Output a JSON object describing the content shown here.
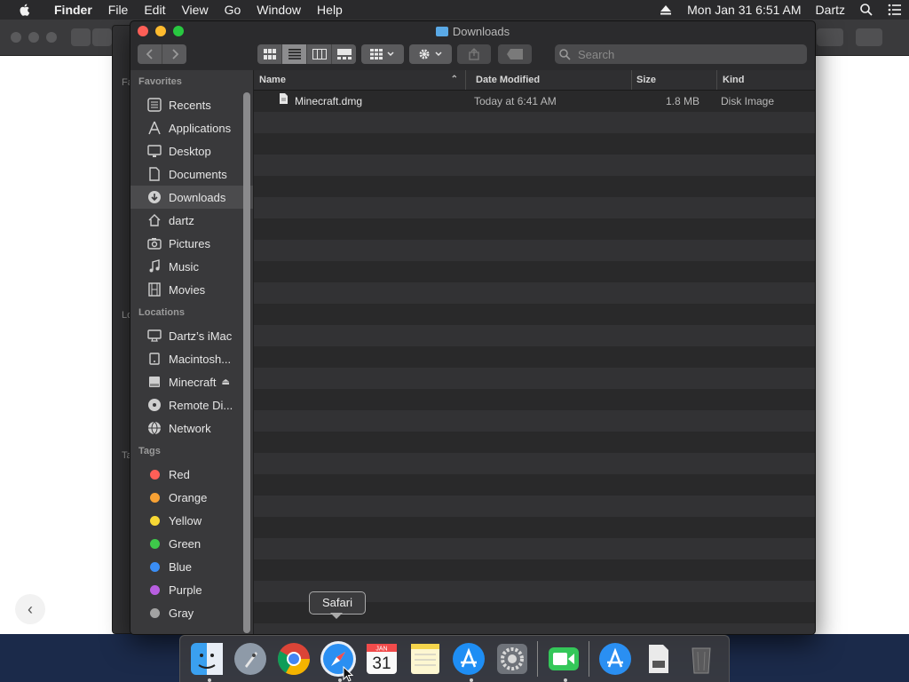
{
  "menubar": {
    "app_name": "Finder",
    "items": [
      "File",
      "Edit",
      "View",
      "Go",
      "Window",
      "Help"
    ],
    "clock": "Mon Jan 31  6:51 AM",
    "user": "Dartz"
  },
  "finder": {
    "title": "Downloads",
    "search": {
      "placeholder": "Search"
    },
    "sidebar": {
      "favorites_header": "Favorites",
      "favorites": [
        {
          "label": "Recents",
          "icon": "recents-icon"
        },
        {
          "label": "Applications",
          "icon": "applications-icon"
        },
        {
          "label": "Desktop",
          "icon": "desktop-icon"
        },
        {
          "label": "Documents",
          "icon": "documents-icon"
        },
        {
          "label": "Downloads",
          "icon": "downloads-icon",
          "selected": true
        },
        {
          "label": "dartz",
          "icon": "home-icon"
        },
        {
          "label": "Pictures",
          "icon": "pictures-icon"
        },
        {
          "label": "Music",
          "icon": "music-icon"
        },
        {
          "label": "Movies",
          "icon": "movies-icon"
        }
      ],
      "locations_header": "Locations",
      "locations": [
        {
          "label": "Dartz’s iMac",
          "icon": "imac-icon"
        },
        {
          "label": "Macintosh...",
          "icon": "hard-drive-icon"
        },
        {
          "label": "Minecraft",
          "icon": "disk-image-icon",
          "ejectable": true
        },
        {
          "label": "Remote Di...",
          "icon": "remote-disc-icon"
        },
        {
          "label": "Network",
          "icon": "network-icon"
        }
      ],
      "tags_header": "Tags",
      "tags": [
        {
          "label": "Red",
          "color": "#fe5f57"
        },
        {
          "label": "Orange",
          "color": "#f7a134"
        },
        {
          "label": "Yellow",
          "color": "#f7d834"
        },
        {
          "label": "Green",
          "color": "#3ec94a"
        },
        {
          "label": "Blue",
          "color": "#3a8ef6"
        },
        {
          "label": "Purple",
          "color": "#b85ee0"
        },
        {
          "label": "Gray",
          "color": "#a3a3a3"
        }
      ]
    },
    "columns": {
      "name": "Name",
      "date": "Date Modified",
      "size": "Size",
      "kind": "Kind"
    },
    "files": [
      {
        "name": "Minecraft.dmg",
        "date": "Today at 6:41 AM",
        "size": "1.8 MB",
        "kind": "Disk Image"
      }
    ]
  },
  "background_window": {
    "sidebar_labels": [
      "Fa",
      "Lo",
      "Ta"
    ]
  },
  "dock": {
    "tooltip": "Safari",
    "calendar_month": "JAN",
    "calendar_day": "31",
    "items": [
      "Finder",
      "Launchpad",
      "Google Chrome",
      "Safari",
      "Calendar",
      "Notes",
      "App Store",
      "System Preferences",
      "FaceTime",
      "App Store Downloads",
      "Document",
      "Trash"
    ]
  }
}
